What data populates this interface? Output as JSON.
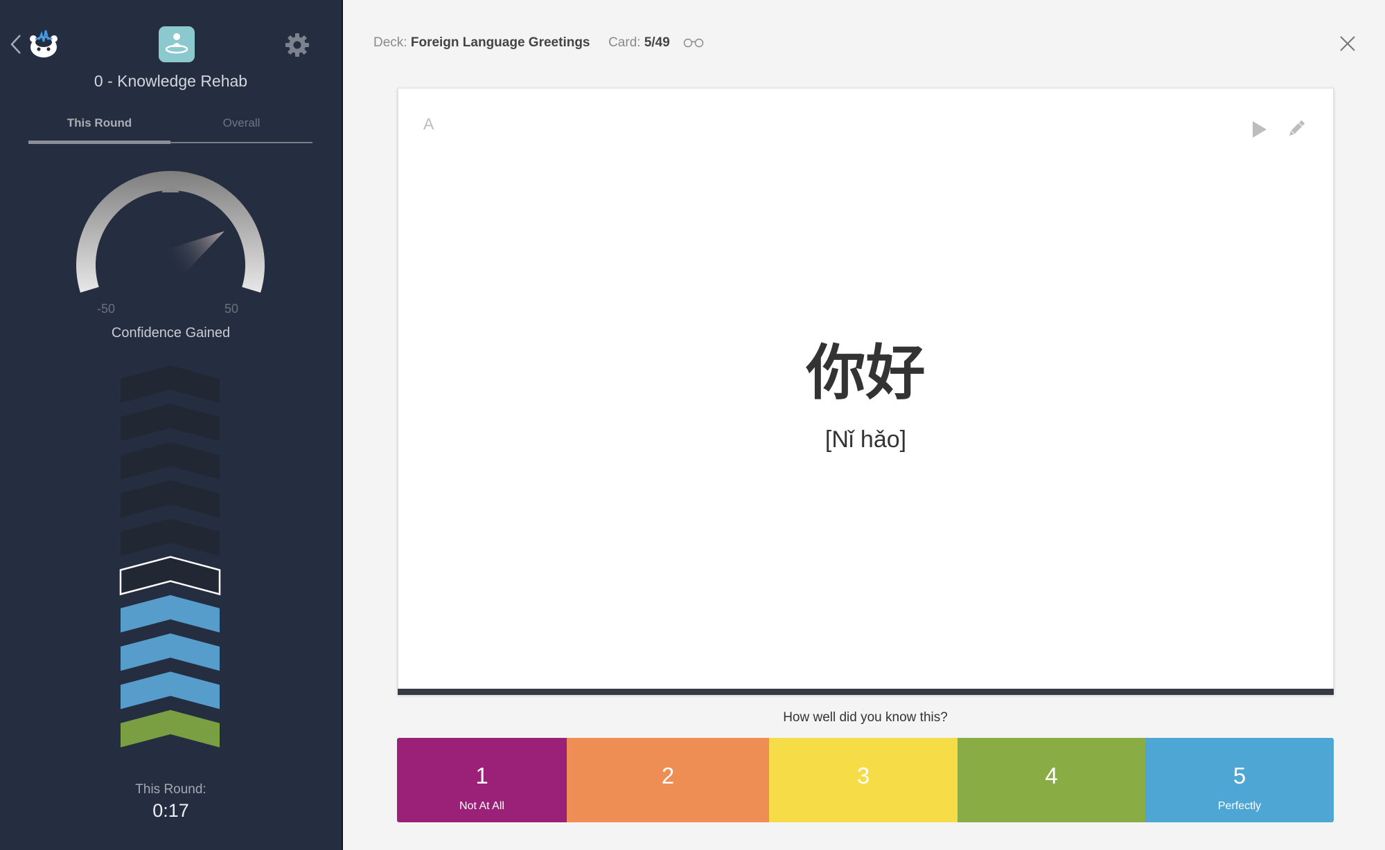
{
  "sidebar": {
    "deck_name": "0 - Knowledge Rehab",
    "tabs": [
      {
        "label": "This Round",
        "active": true
      },
      {
        "label": "Overall",
        "active": false
      }
    ],
    "gauge": {
      "min_label": "-50",
      "max_label": "50",
      "min": -50,
      "max": 50,
      "value_estimate": 27,
      "label": "Confidence Gained"
    },
    "progress_chevrons": [
      "empty",
      "empty",
      "empty",
      "empty",
      "empty",
      "current",
      "blue",
      "blue",
      "blue",
      "green"
    ],
    "chevron_colors": {
      "empty": "#222734",
      "current": "#222734",
      "blue": "#579dcb",
      "green": "#7a9f43"
    },
    "round_label": "This Round:",
    "round_time": "0:17"
  },
  "header": {
    "deck_prefix": "Deck:",
    "deck_name": "Foreign Language Greetings",
    "card_prefix": "Card:",
    "card_position": "5/49",
    "glasses_icon": "glasses-icon",
    "close_icon": "close-icon"
  },
  "card": {
    "side_label": "A",
    "front_text": "你好",
    "back_text": "[Nǐ hǎo]"
  },
  "rating": {
    "prompt": "How well did you know this?",
    "buttons": [
      {
        "value": "1",
        "label": "Not At All",
        "color": "#9b2178"
      },
      {
        "value": "2",
        "label": "",
        "color": "#ee8e55"
      },
      {
        "value": "3",
        "label": "",
        "color": "#f6dd48"
      },
      {
        "value": "4",
        "label": "",
        "color": "#8aac45"
      },
      {
        "value": "5",
        "label": "Perfectly",
        "color": "#4ea6d5"
      }
    ]
  }
}
